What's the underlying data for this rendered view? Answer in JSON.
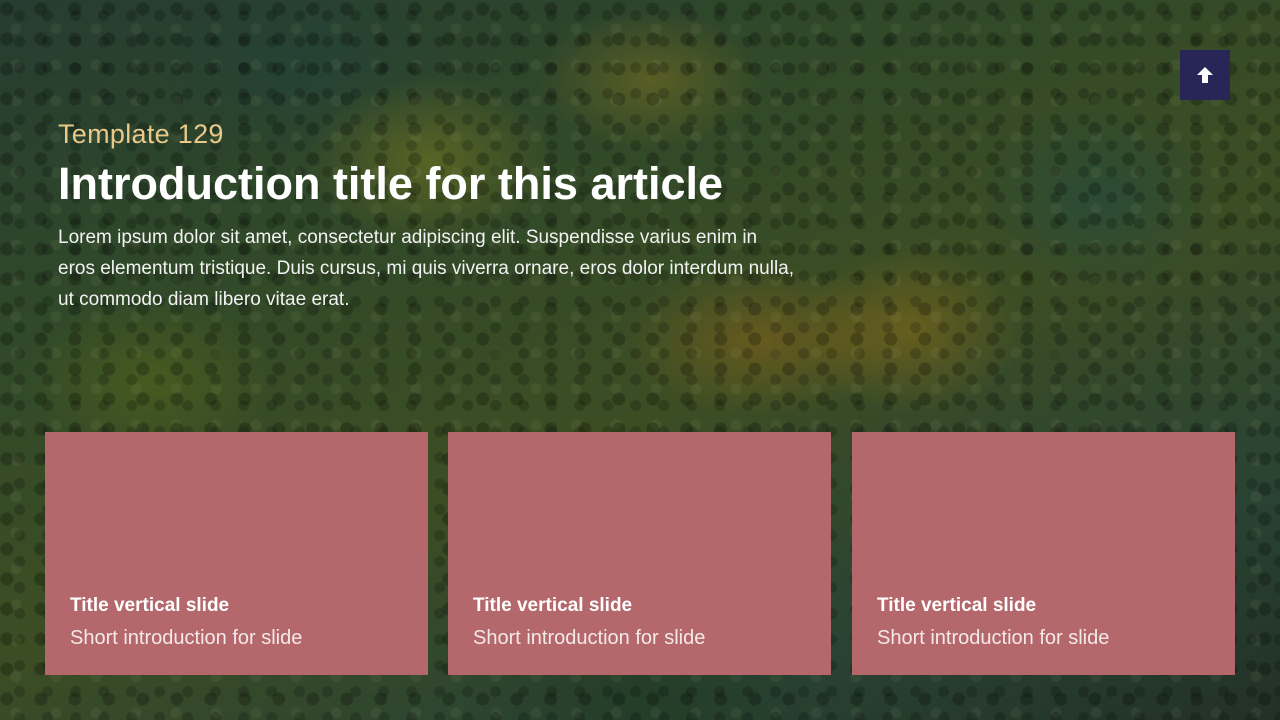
{
  "accent": {
    "eyebrow": "#e8c98a",
    "card": "#b5686b",
    "button": "#272656"
  },
  "header": {
    "eyebrow": "Template 129",
    "title": "Introduction title for this article",
    "body": "Lorem ipsum dolor sit amet, consectetur adipiscing elit. Suspendisse varius enim in eros elementum tristique. Duis cursus, mi quis viverra ornare, eros dolor interdum nulla, ut commodo diam libero vitae erat."
  },
  "scroll_top_button": {
    "icon": "arrow-up-icon"
  },
  "cards": [
    {
      "title": "Title vertical slide",
      "subtitle": "Short introduction for slide"
    },
    {
      "title": "Title vertical slide",
      "subtitle": "Short introduction for slide"
    },
    {
      "title": "Title vertical slide",
      "subtitle": "Short introduction for slide"
    }
  ]
}
